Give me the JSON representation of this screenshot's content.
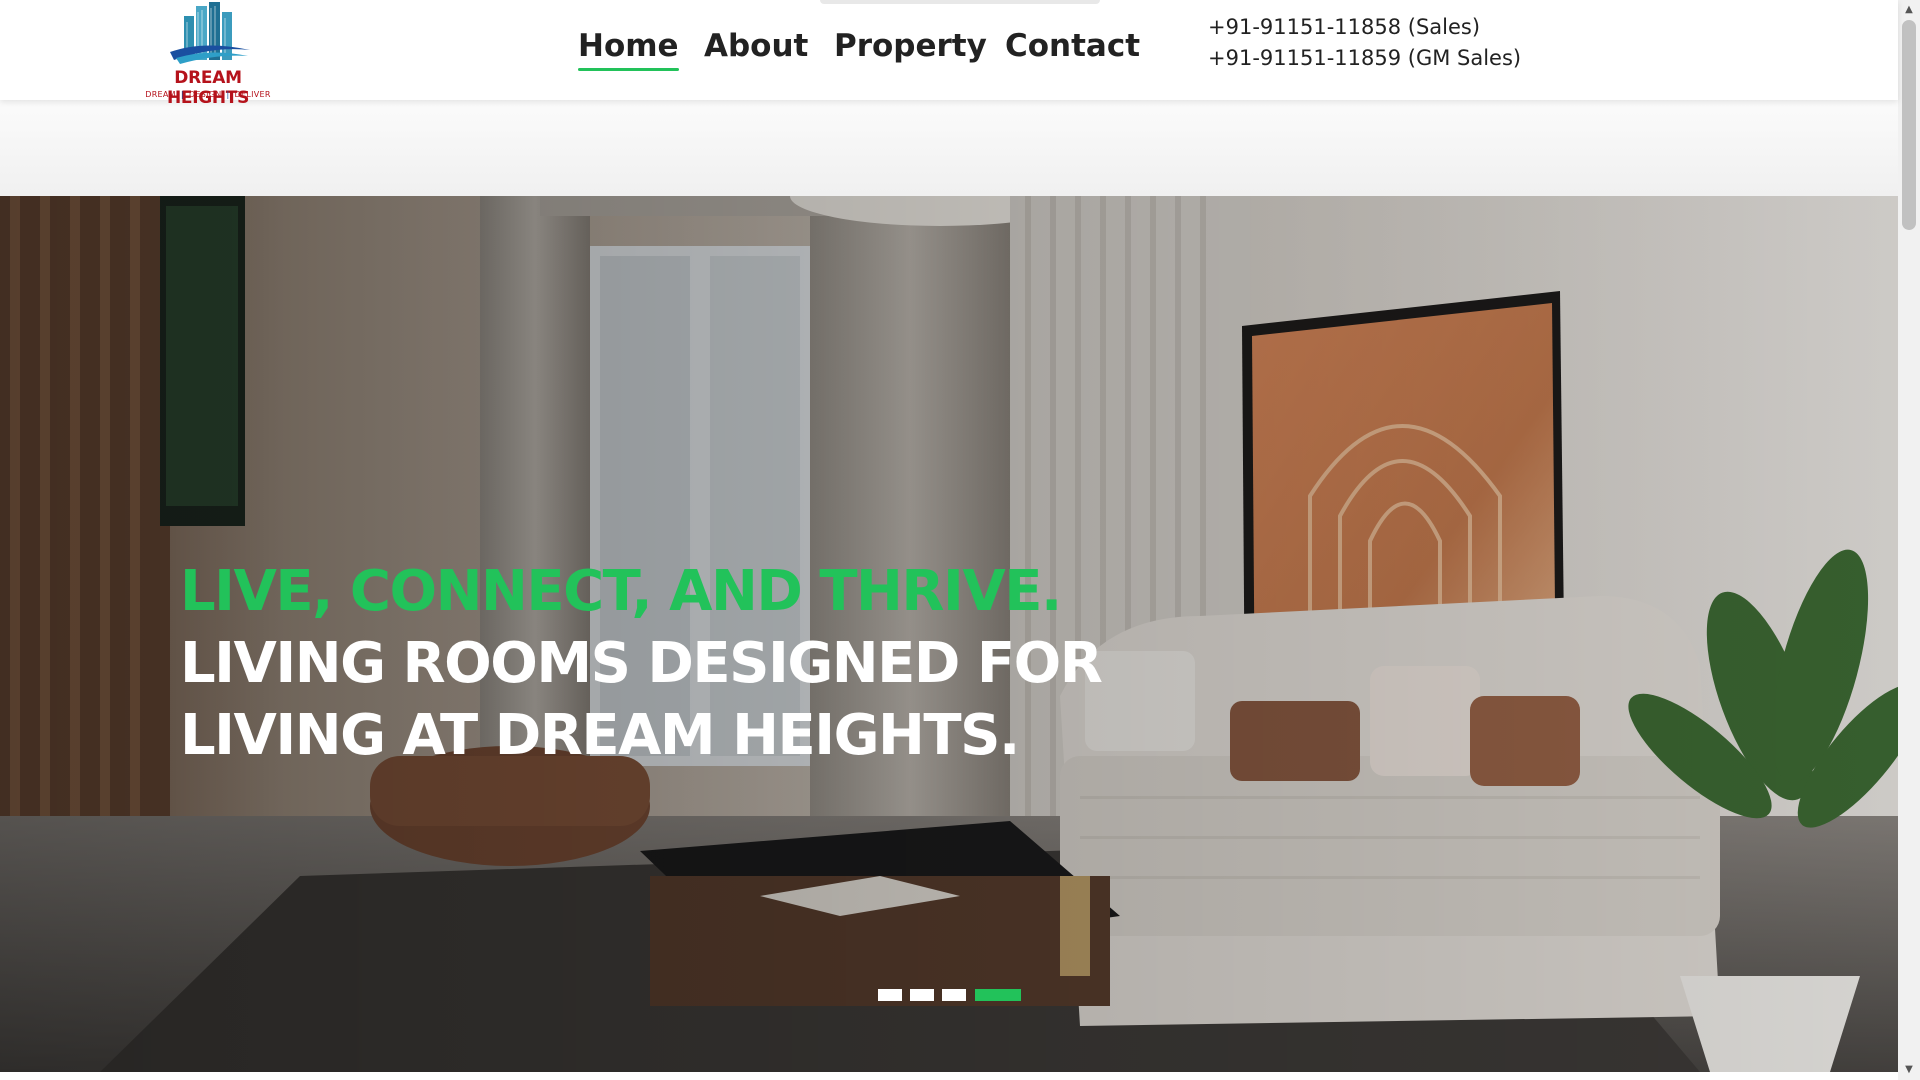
{
  "brand": {
    "name": "DREAM HEIGHTS",
    "tagline": [
      "DREAM",
      "DESIGN",
      "DELIVER"
    ],
    "color": "#b5121b"
  },
  "nav": {
    "items": [
      {
        "label": "Home",
        "active": true
      },
      {
        "label": "About",
        "active": false
      },
      {
        "label": "Property",
        "active": false
      },
      {
        "label": "Contact",
        "active": false
      }
    ]
  },
  "contact": {
    "phones": [
      "+91-91151-11858 (Sales)",
      "+91-91151-11859 (GM Sales)"
    ]
  },
  "hero": {
    "line1": "LIVE, CONNECT, AND THRIVE.",
    "line2": "LIVING ROOMS DESIGNED FOR",
    "line3": "LIVING AT DREAM HEIGHTS.",
    "slides": 4,
    "active_slide": 4
  },
  "colors": {
    "accent": "#22c25a",
    "text": "#222222"
  },
  "icons": {
    "logo": "building-skyline-icon",
    "scroll_up": "arrow-up-icon",
    "scroll_down": "arrow-down-icon"
  }
}
